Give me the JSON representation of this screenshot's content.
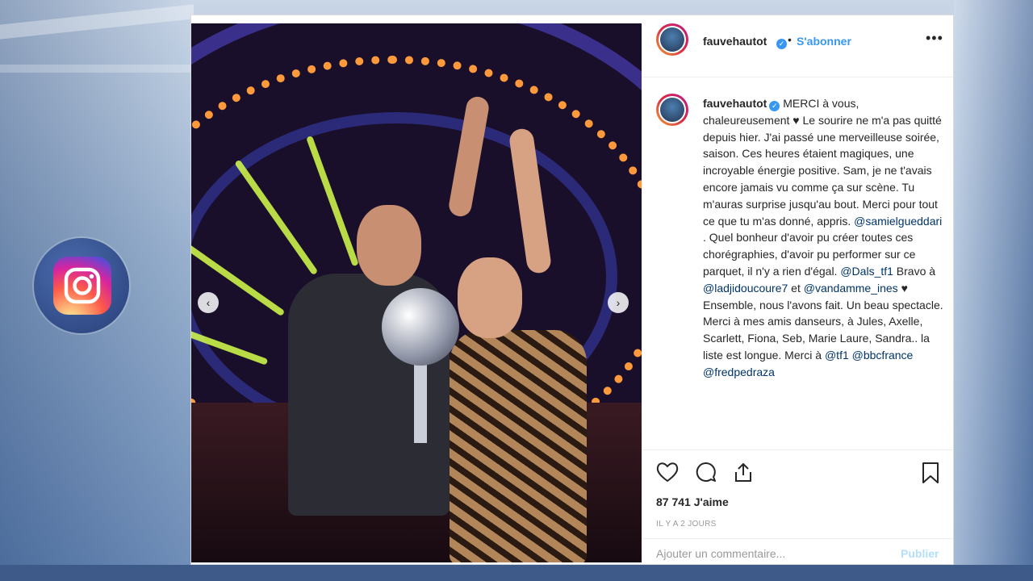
{
  "post": {
    "username": "fauvehautot",
    "follow_label": "S'abonner",
    "separator": "•",
    "more_label": "•••",
    "caption": {
      "username": "fauvehautot",
      "segments": [
        {
          "text": " MERCI à vous, chaleureusement ♥ Le sourire ne m'a pas quitté depuis hier. J'ai passé une merveilleuse soirée, saison. Ces heures étaient magiques, une incroyable énergie positive. Sam, je ne t'avais encore jamais vu comme ça sur scène. Tu m'auras surprise jusqu'au bout. Merci pour tout ce que tu m'as donné, appris. ",
          "type": "text"
        },
        {
          "text": "@samielgueddari",
          "type": "mention"
        },
        {
          "text": " . Quel bonheur d'avoir pu créer toutes ces chorégraphies, d'avoir pu performer sur ce parquet, il n'y a rien d'égal. ",
          "type": "text"
        },
        {
          "text": "@Dals_tf1",
          "type": "mention"
        },
        {
          "text": " Bravo à ",
          "type": "text"
        },
        {
          "text": "@ladjidoucoure7",
          "type": "mention"
        },
        {
          "text": " et ",
          "type": "text"
        },
        {
          "text": "@vandamme_ines",
          "type": "mention"
        },
        {
          "text": " ♥ Ensemble, nous l'avons fait. Un beau spectacle. Merci à mes amis danseurs, à Jules, Axelle, Scarlett, Fiona, Seb, Marie Laure, Sandra.. la liste est longue. Merci à ",
          "type": "text"
        },
        {
          "text": "@tf1",
          "type": "mention"
        },
        {
          "text": " ",
          "type": "text"
        },
        {
          "text": "@bbcfrance",
          "type": "mention"
        },
        {
          "text": " ",
          "type": "text"
        },
        {
          "text": "@fredpedraza",
          "type": "mention"
        }
      ]
    },
    "likes": "87 741 J'aime",
    "timestamp": "IL Y A 2 JOURS",
    "comment_placeholder": "Ajouter un commentaire...",
    "publish_label": "Publier",
    "carousel": {
      "prev": "‹",
      "next": "›",
      "dots": 3,
      "active": 1
    }
  },
  "icons": {
    "instagram": "instagram-icon",
    "heart": "heart-icon",
    "comment": "comment-icon",
    "share": "share-icon",
    "bookmark": "bookmark-icon",
    "verified": "verified-badge-icon"
  },
  "colors": {
    "link": "#3897f0",
    "mention": "#003569",
    "text": "#262626",
    "muted": "#999999",
    "publish_disabled": "#b2dffc"
  }
}
